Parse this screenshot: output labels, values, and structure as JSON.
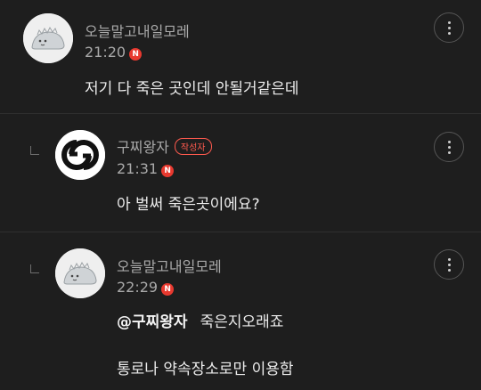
{
  "comments": [
    {
      "author": "오늘말고내일모레",
      "time": "21:20",
      "new_badge": "N",
      "text": "저기 다 죽은 곳인데 안될거같은데"
    },
    {
      "author": "구찌왕자",
      "author_badge": "작성자",
      "time": "21:31",
      "new_badge": "N",
      "text": "아 벌써 죽은곳이에요?"
    },
    {
      "author": "오늘말고내일모레",
      "time": "22:29",
      "new_badge": "N",
      "mention": "@구찌왕자",
      "text": "죽은지오래죠",
      "text2": "통로나 약속장소로만 이용함"
    }
  ]
}
